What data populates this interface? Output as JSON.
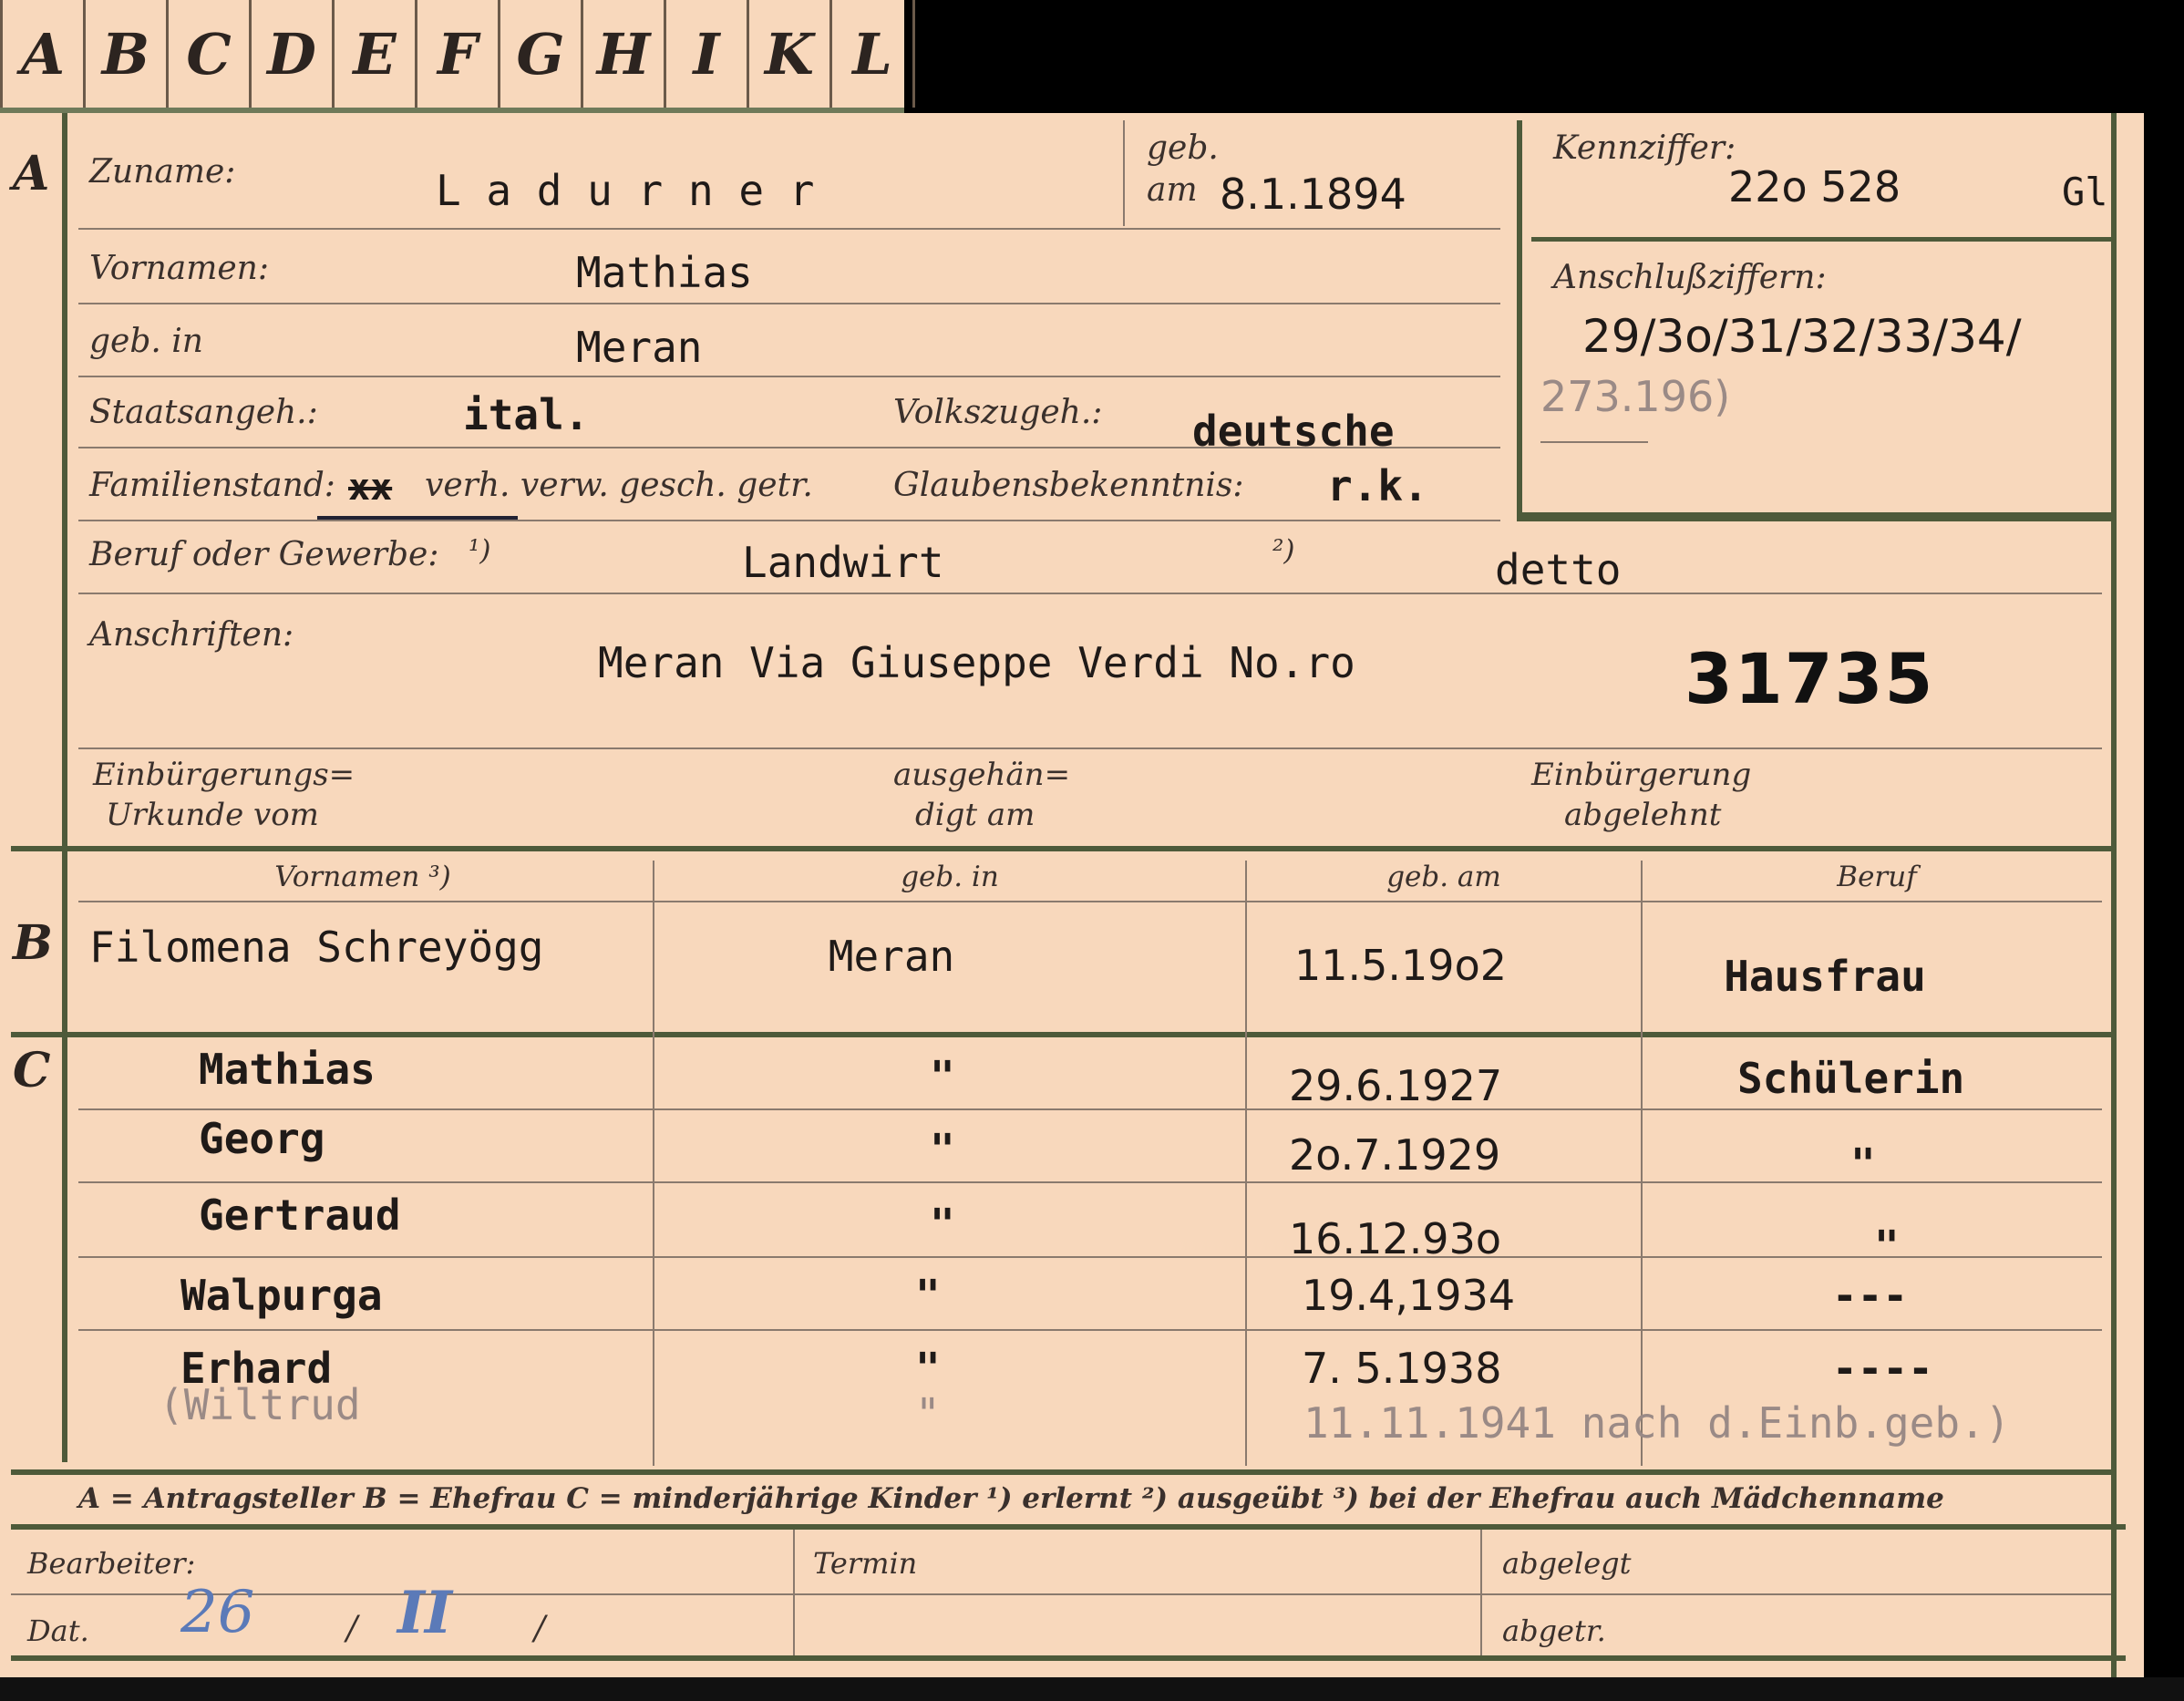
{
  "tabs": [
    "A",
    "B",
    "C",
    "D",
    "E",
    "F",
    "G",
    "H",
    "I",
    "K",
    "L"
  ],
  "section_a": {
    "marker": "A",
    "zuname_label": "Zuname:",
    "zuname": "L a d u r n e r",
    "geb_label": "geb.",
    "geb_am_label": "am",
    "geb_am": "8.1.1894",
    "kennziffer_label": "Kennziffer:",
    "kennziffer": "22o 528",
    "kennziffer_suffix": "Gl",
    "anschluss_label": "Anschlußziffern:",
    "anschluss_value": "29/3o/31/32/33/34/",
    "anschluss_value2": "273.196)",
    "vornamen_label": "Vornamen:",
    "vornamen": "Mathias",
    "geb_in_label": "geb. in",
    "geb_in": "Meran",
    "staats_label": "Staatsangeh.:",
    "staats": "ital.",
    "volks_label": "Volkszugeh.:",
    "volks": "deutsche",
    "familien_label": "Familienstand:",
    "familien_struck": "xx",
    "familien_options": "verh.  verw.  gesch.  getr.",
    "glauben_label": "Glaubensbekenntnis:",
    "glauben": "r.k.",
    "beruf_label": "Beruf oder Gewerbe:",
    "beruf_note1": "¹)",
    "beruf_erlernt": "Landwirt",
    "beruf_note2": "²)",
    "beruf_ausgeuebt": "detto",
    "anschriften_label": "Anschriften:",
    "anschrift": "Meran Via Giuseppe  Verdi No.ro",
    "stamp_number": "31735",
    "einb_label_1": "Einbürgerungs=",
    "einb_label_2": "Urkunde vom",
    "ausgeh_label_1": "ausgehän=",
    "ausgeh_label_2": "digt am",
    "abgelehnt_label_1": "Einbürgerung",
    "abgelehnt_label_2": "abgelehnt"
  },
  "section_b": {
    "marker": "B",
    "headers": [
      "Vornamen ³)",
      "geb. in",
      "geb. am",
      "Beruf"
    ],
    "row": {
      "name": "Filomena Schreyögg",
      "geb_in": "Meran",
      "geb_am": "11.5.19o2",
      "beruf": "Hausfrau"
    }
  },
  "section_c": {
    "marker": "C",
    "children": [
      {
        "name": "Mathias",
        "geb_in": "\"",
        "geb_am": "29.6.1927",
        "beruf": "Schülerin"
      },
      {
        "name": "Georg",
        "geb_in": "\"",
        "geb_am": "2o.7.1929",
        "beruf": "\""
      },
      {
        "name": "Gertraud",
        "geb_in": "\"",
        "geb_am": "16.12.93o",
        "beruf": "\""
      },
      {
        "name": "Walpurga",
        "geb_in": "\"",
        "geb_am": "19.4,1934",
        "beruf": "---"
      },
      {
        "name": "Erhard",
        "geb_in": "\"",
        "geb_am": "7. 5.1938",
        "beruf": "----"
      }
    ],
    "faint_row": {
      "name": "(Wiltrud",
      "geb_in": "\"",
      "note": "11.11.1941 nach d.Einb.geb.)"
    }
  },
  "legend": "A = Antragsteller   B = Ehefrau   C = minderjährige Kinder   ¹) erlernt   ²) ausgeübt   ³) bei der Ehefrau auch Mädchenname",
  "footer": {
    "bearbeiter_label": "Bearbeiter:",
    "termin_label": "Termin",
    "abgelegt_label": "abgelegt",
    "dat_label": "Dat.",
    "dat_day": "26",
    "dat_sep1": "/",
    "dat_month": "II",
    "dat_sep2": "/",
    "abgetr_label": "abgetr."
  }
}
